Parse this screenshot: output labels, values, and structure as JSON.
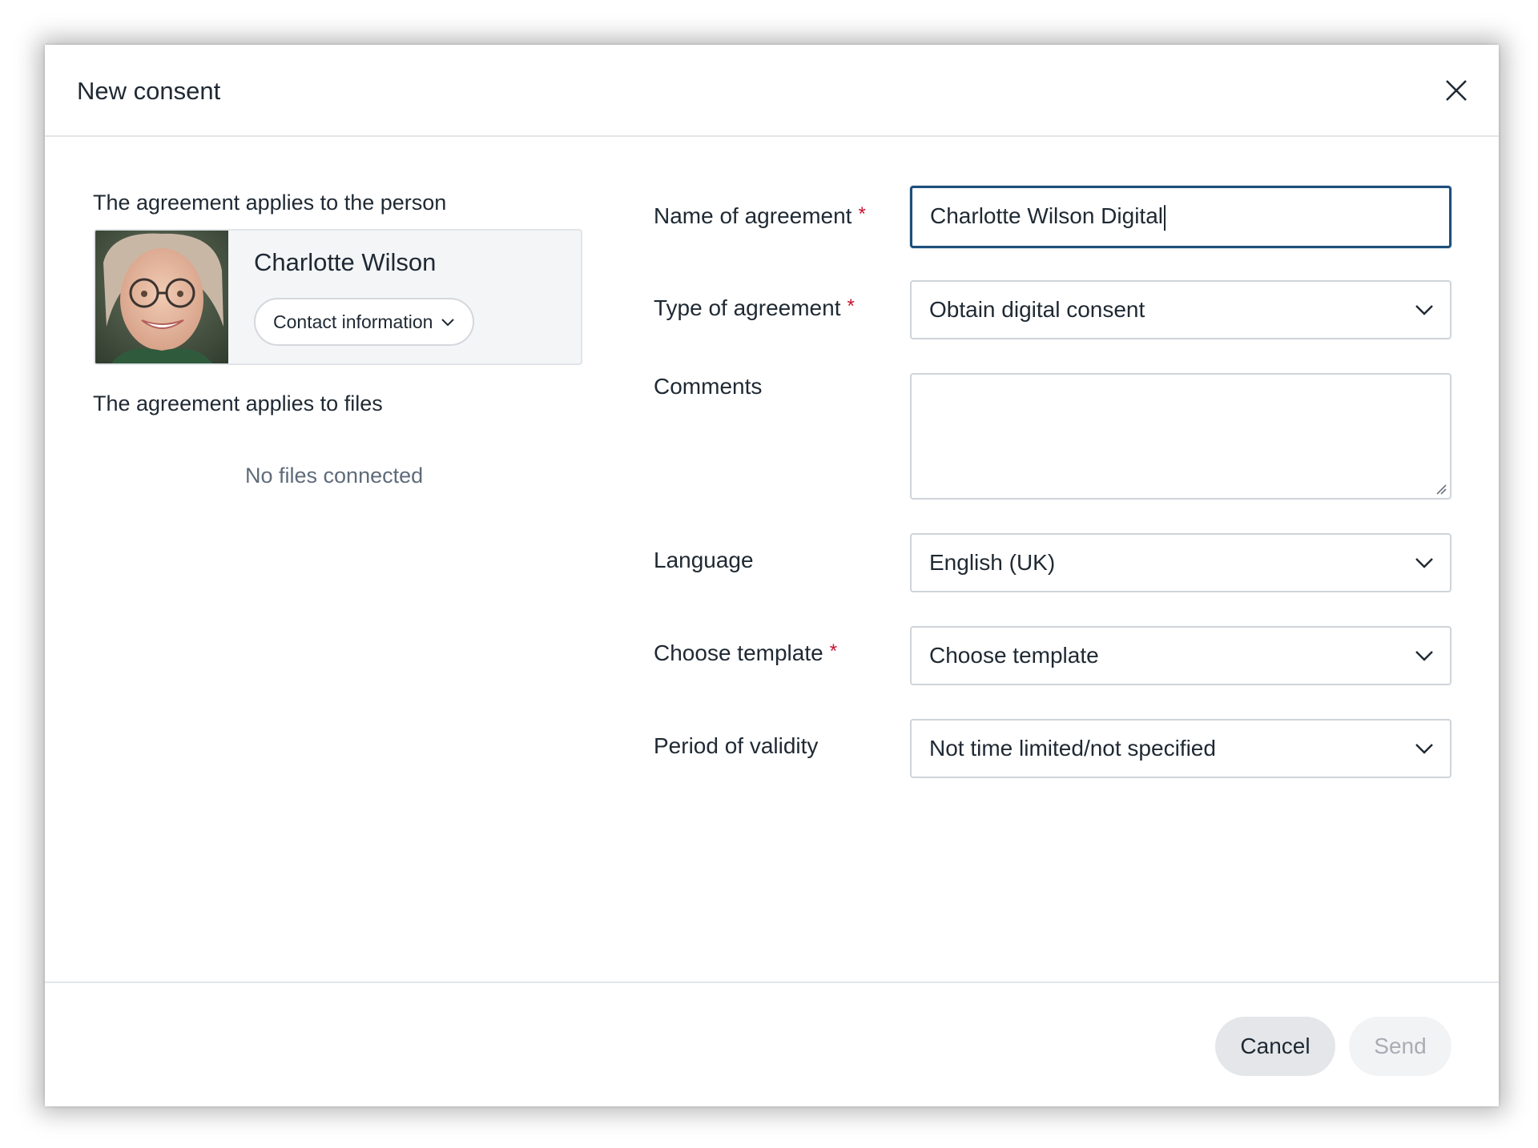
{
  "dialog": {
    "title": "New consent",
    "close_icon": "close-icon"
  },
  "person_section": {
    "label": "The agreement applies to the person",
    "name": "Charlotte Wilson",
    "contact_button_label": "Contact information"
  },
  "files_section": {
    "label": "The agreement applies to files",
    "empty_text": "No files connected"
  },
  "form": {
    "name_of_agreement": {
      "label": "Name of agreement",
      "required_mark": "*",
      "value": "Charlotte Wilson Digital"
    },
    "type_of_agreement": {
      "label": "Type of agreement",
      "required_mark": "*",
      "value": "Obtain digital consent"
    },
    "comments": {
      "label": "Comments",
      "value": ""
    },
    "language": {
      "label": "Language",
      "value": "English (UK)"
    },
    "template": {
      "label": "Choose template",
      "required_mark": "*",
      "value": "Choose template"
    },
    "validity": {
      "label": "Period of validity",
      "value": "Not time limited/not specified"
    }
  },
  "footer": {
    "cancel_label": "Cancel",
    "send_label": "Send"
  },
  "colors": {
    "focus_border": "#1d4f7c",
    "required": "#c8102e",
    "muted_text": "#5f6b7a"
  }
}
